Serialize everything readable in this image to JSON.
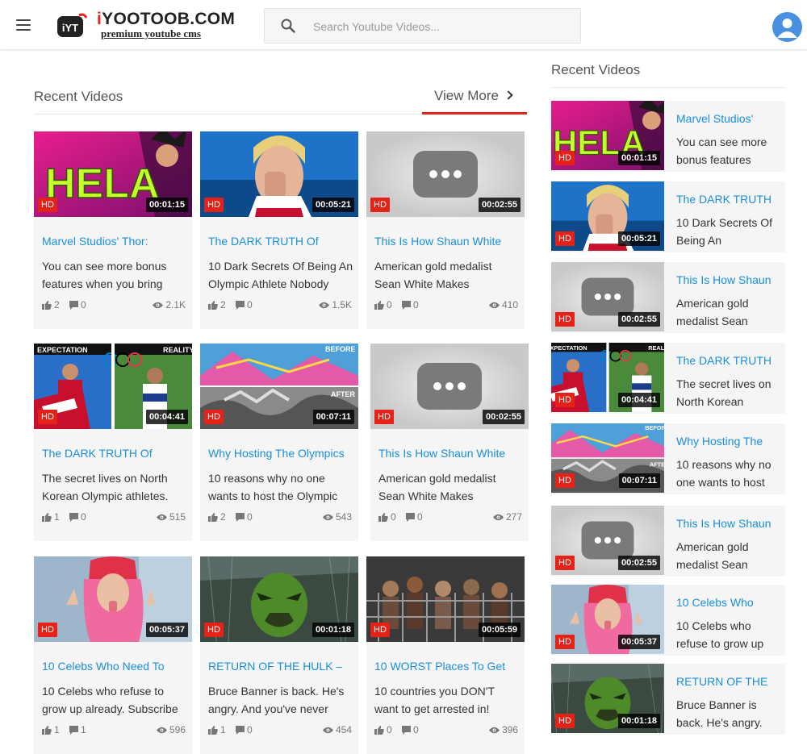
{
  "header": {
    "logo_badge": "iYT",
    "logo_title_first": "i",
    "logo_title_rest": "YOOTOOB.COM",
    "logo_subtitle": "premium youtube cms",
    "search_placeholder": "Search Youtube Videos...",
    "icons": [
      "hamburger-icon",
      "logo-icon",
      "search-icon",
      "avatar-icon"
    ]
  },
  "main": {
    "section_title": "Recent Videos",
    "view_more_label": "View More",
    "hd_label": "HD",
    "videos": [
      {
        "title": "Marvel Studios' Thor:",
        "desc": "You can see more bonus features when you bring",
        "likes": "2",
        "comments": "0",
        "views": "2.1K",
        "duration": "00:01:15"
      },
      {
        "title": "The DARK TRUTH Of",
        "desc": "10 Dark Secrets Of Being An Olympic Athlete Nobody",
        "likes": "2",
        "comments": "0",
        "views": "1.5K",
        "duration": "00:05:21"
      },
      {
        "title": "This Is How Shaun White",
        "desc": "American gold medalist Sean White Makes",
        "likes": "0",
        "comments": "0",
        "views": "410",
        "duration": "00:02:55"
      },
      {
        "title": "The DARK TRUTH Of",
        "desc": "The secret lives on North Korean Olympic athletes.",
        "likes": "1",
        "comments": "0",
        "views": "515",
        "duration": "00:04:41"
      },
      {
        "title": "Why Hosting The Olympics",
        "desc": "10 reasons why no one wants to host the Olympic",
        "likes": "2",
        "comments": "0",
        "views": "543",
        "duration": "00:07:11"
      },
      {
        "title": "This Is How Shaun White",
        "desc": "American gold medalist Sean White Makes",
        "likes": "0",
        "comments": "0",
        "views": "277",
        "duration": "00:02:55"
      },
      {
        "title": "10 Celebs Who Need To",
        "desc": "10 Celebs who refuse to grow up already. Subscribe",
        "likes": "1",
        "comments": "1",
        "views": "596",
        "duration": "00:05:37"
      },
      {
        "title": "RETURN OF THE HULK –",
        "desc": "Bruce Banner is back. He's angry. And you've never",
        "likes": "1",
        "comments": "0",
        "views": "454",
        "duration": "00:01:18"
      },
      {
        "title": "10 WORST Places To Get",
        "desc": "10 countries you DON'T want to get arrested in!",
        "likes": "0",
        "comments": "0",
        "views": "396",
        "duration": "00:05:59"
      }
    ]
  },
  "sidebar": {
    "section_title": "Recent Videos",
    "items": [
      {
        "title": "Marvel Studios'",
        "desc": "You can see more bonus features",
        "duration": "00:01:15"
      },
      {
        "title": "The DARK TRUTH",
        "desc": "10 Dark Secrets Of Being An",
        "duration": "00:05:21"
      },
      {
        "title": "This Is How Shaun",
        "desc": "American gold medalist Sean",
        "duration": "00:02:55"
      },
      {
        "title": "The DARK TRUTH",
        "desc": "The secret lives on North Korean",
        "duration": "00:04:41"
      },
      {
        "title": "Why Hosting The",
        "desc": "10 reasons why no one wants to host",
        "duration": "00:07:11"
      },
      {
        "title": "This Is How Shaun",
        "desc": "American gold medalist Sean",
        "duration": "00:02:55"
      },
      {
        "title": "10 Celebs Who",
        "desc": "10 Celebs who refuse to grow up",
        "duration": "00:05:37"
      },
      {
        "title": "RETURN OF THE",
        "desc": "Bruce Banner is back. He's angry.",
        "duration": "00:01:18"
      }
    ]
  },
  "thumb_images": [
    "hela-thor-image",
    "crying-athlete-image",
    "placeholder-play-image",
    "north-korea-athletes-image",
    "olympics-before-after-image",
    "placeholder-play-image",
    "celeb-tongue-image",
    "hulk-image",
    "prison-image"
  ],
  "colors": {
    "accent": "#e62117",
    "link": "#1a8fd8",
    "card_bg": "#f5f5f5",
    "hela_text": "#c6ff2e",
    "avatar": "#4a90e2"
  }
}
